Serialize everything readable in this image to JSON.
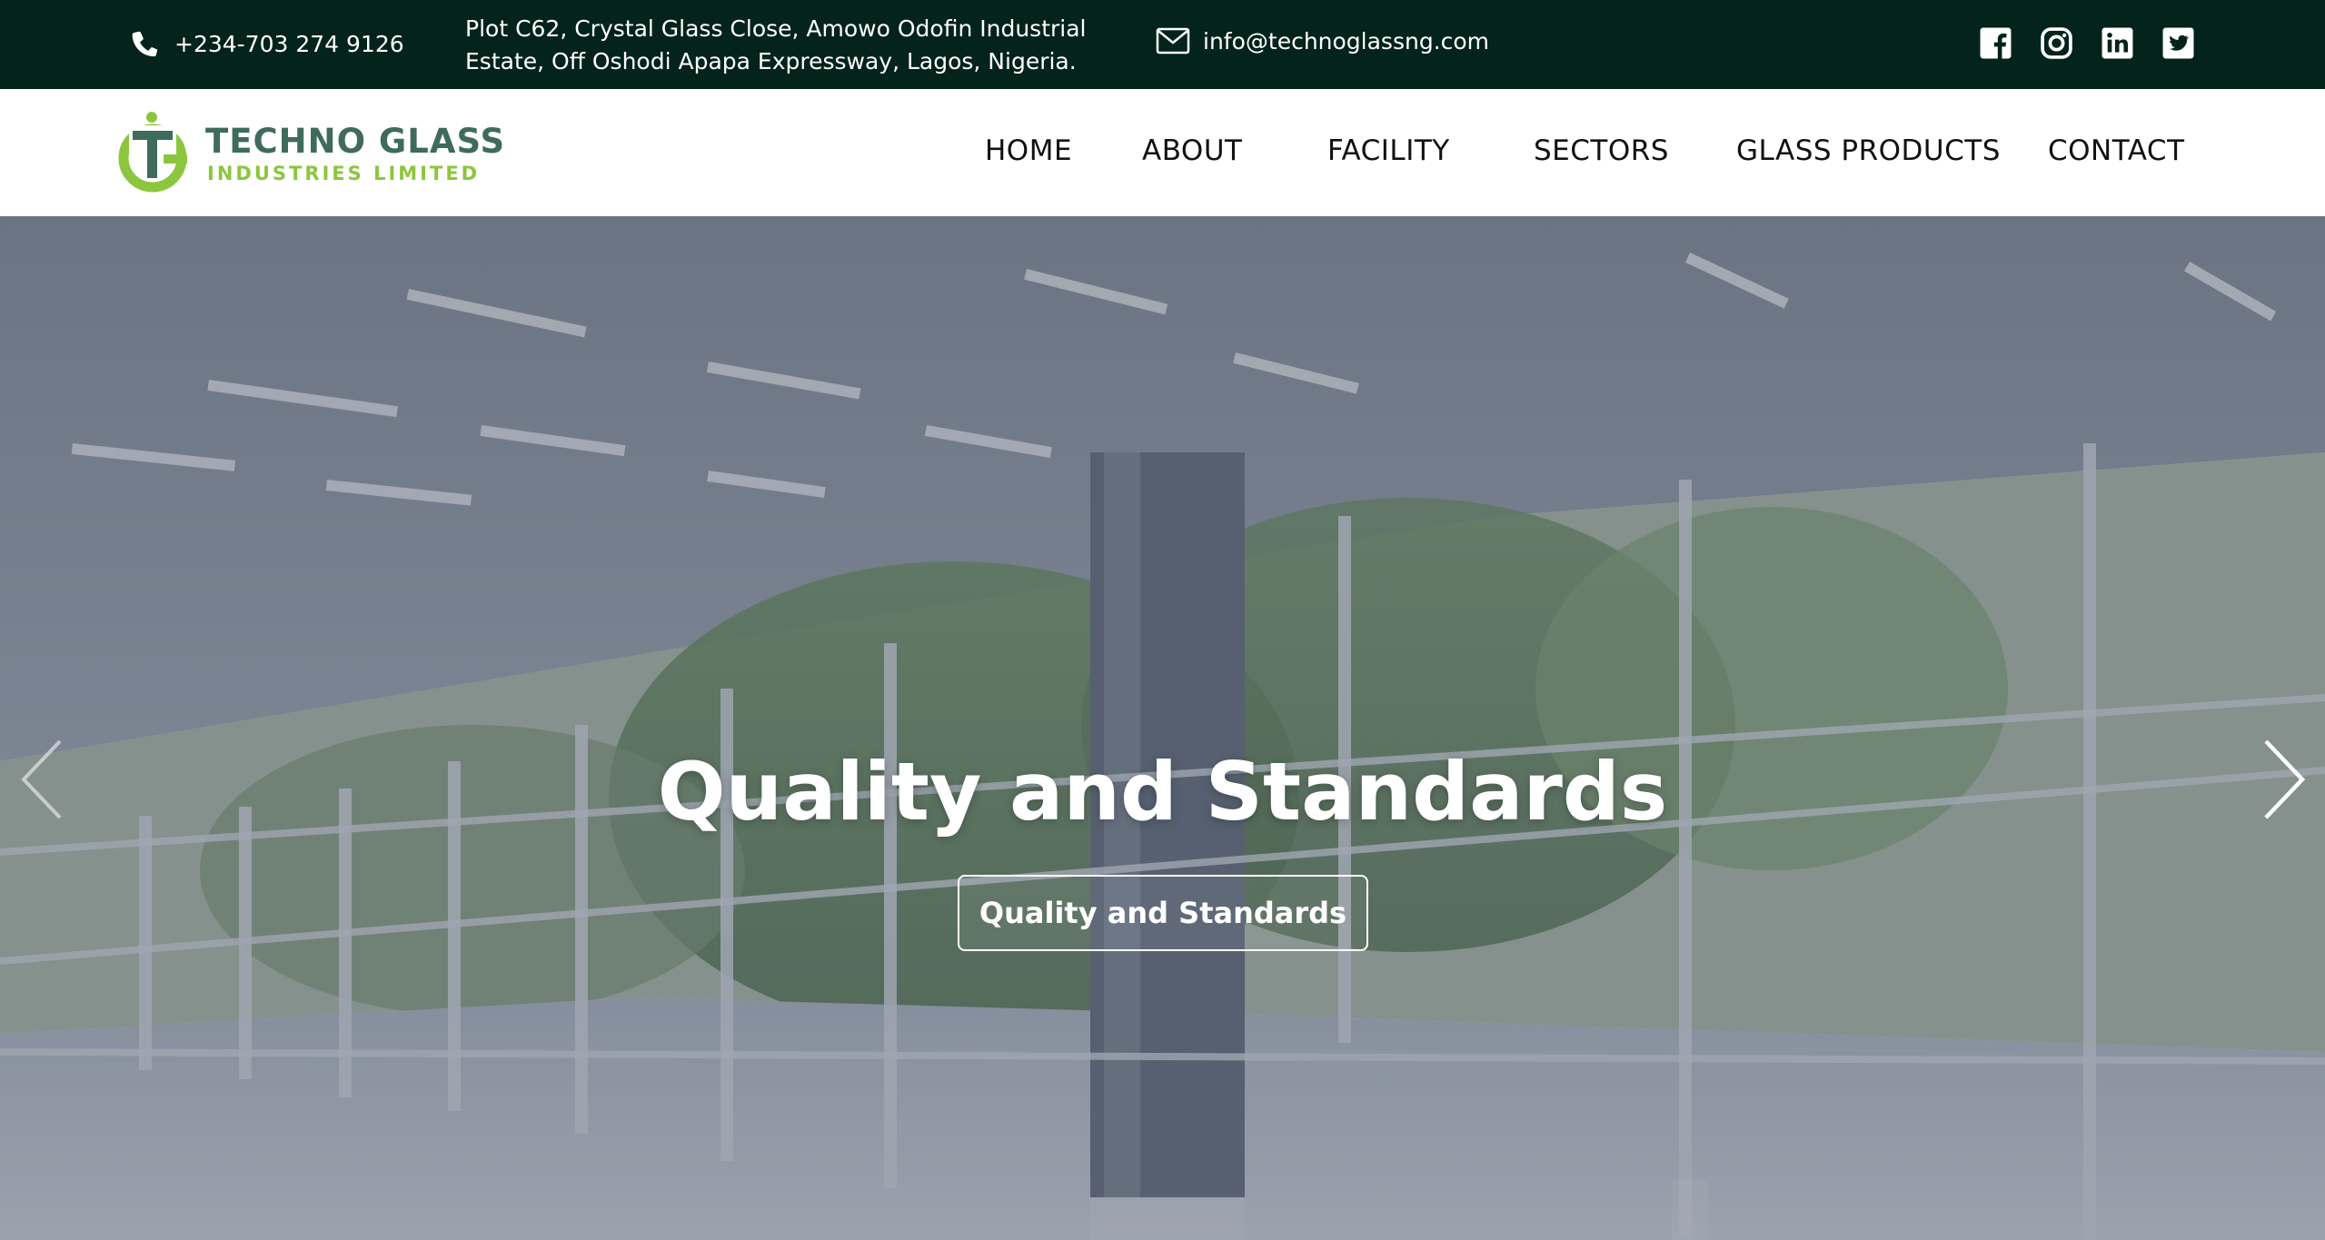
{
  "topbar": {
    "phone": "+234-703 274 9126",
    "address_line1": "Plot C62, Crystal Glass Close, Amowo Odofin Industrial",
    "address_line2": "Estate, Off Oshodi Apapa Expressway, Lagos, Nigeria.",
    "email": "info@technoglassng.com",
    "social_icons": [
      "facebook-icon",
      "instagram-icon",
      "linkedin-icon",
      "twitter-icon"
    ]
  },
  "logo": {
    "name": "TECHNO GLASS",
    "sub": "INDUSTRIES LIMITED"
  },
  "nav": {
    "items": [
      {
        "label": "HOME"
      },
      {
        "label": "ABOUT"
      },
      {
        "label": "FACILITY"
      },
      {
        "label": "SECTORS"
      },
      {
        "label": "GLASS PRODUCTS"
      },
      {
        "label": "CONTACT"
      }
    ]
  },
  "hero": {
    "title": "Quality and Standards",
    "button_label": "Quality and Standards"
  },
  "colors": {
    "topbar_bg": "#03231b",
    "logo_green_dark": "#3f6b5c",
    "logo_green_light": "#8cc63f",
    "nav_text": "#111111",
    "hero_text": "#ffffff"
  }
}
